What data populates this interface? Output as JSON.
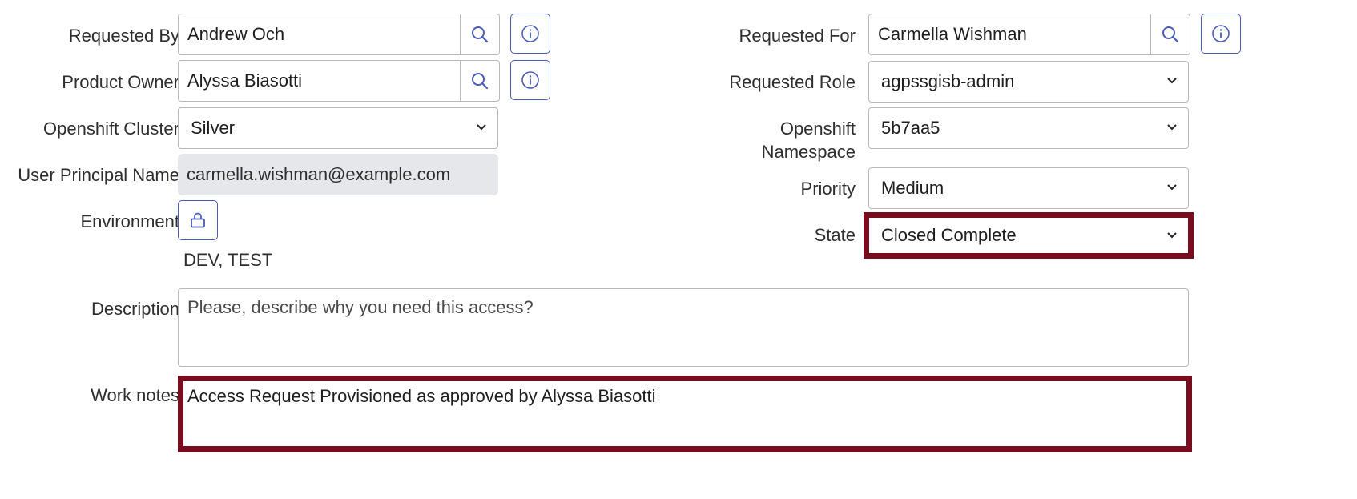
{
  "left": {
    "requested_by": {
      "label": "Requested By",
      "value": "Andrew Och"
    },
    "product_owner": {
      "label": "Product Owner",
      "value": "Alyssa Biasotti"
    },
    "openshift_cluster": {
      "label": "Openshift Cluster",
      "value": "Silver"
    },
    "user_principal_name": {
      "label": "User Principal Name",
      "value": "carmella.wishman@example.com"
    },
    "environment": {
      "label": "Environment",
      "value": "DEV, TEST"
    }
  },
  "right": {
    "requested_for": {
      "label": "Requested For",
      "value": "Carmella Wishman"
    },
    "requested_role": {
      "label": "Requested Role",
      "value": "agpssgisb-admin"
    },
    "openshift_namespace": {
      "label": "Openshift Namespace",
      "value": "5b7aa5"
    },
    "priority": {
      "label": "Priority",
      "value": "Medium"
    },
    "state": {
      "label": "State",
      "value": "Closed Complete"
    }
  },
  "description": {
    "label": "Description",
    "placeholder": "Please, describe why you need this access?"
  },
  "work_notes": {
    "label": "Work notes",
    "value": "Access Request Provisioned as approved by Alyssa Biasotti"
  },
  "colors": {
    "highlight": "#7a0c20",
    "icon_accent": "#4b5bb8",
    "readonly_bg": "#e6e7ea"
  },
  "icons": {
    "search": "search-icon",
    "info": "info-icon",
    "lock": "lock-icon",
    "chevron": "chevron-down-icon"
  }
}
